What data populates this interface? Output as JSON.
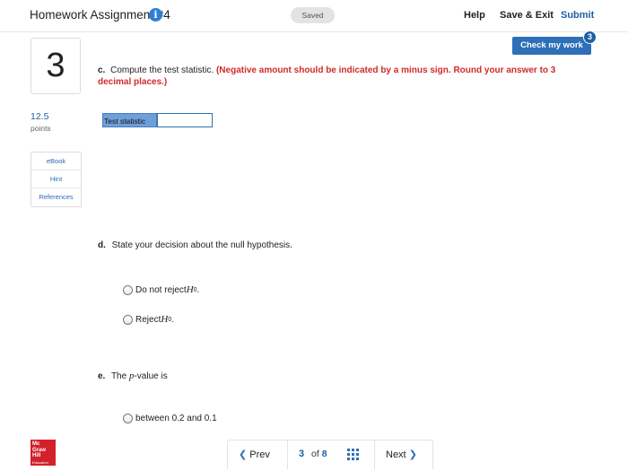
{
  "header": {
    "title": "Homework Assignment #4",
    "info_icon": "info-icon",
    "saved": "Saved",
    "help": "Help",
    "save_exit": "Save & Exit",
    "submit": "Submit"
  },
  "check_work": {
    "label": "Check my work",
    "badge": "3"
  },
  "question": {
    "number": "3",
    "points_value": "12.5",
    "points_label": "points"
  },
  "resources": [
    "eBook",
    "Hint",
    "References"
  ],
  "part_c": {
    "label": "c.",
    "text": "Compute the test statistic.",
    "instruction": "(Negative amount should be indicated by a minus sign. Round your answer to 3 decimal places.)",
    "field_label": "Test statistic",
    "field_value": ""
  },
  "part_d": {
    "label": "d.",
    "text": "State your decision about the null hypothesis.",
    "options": [
      {
        "text": "Do not reject ",
        "symbol": "H",
        "subscript": "0",
        "end": "."
      },
      {
        "text": "Reject ",
        "symbol": "H",
        "subscript": "0",
        "end": "."
      }
    ]
  },
  "part_e": {
    "label": "e.",
    "text_pre": "The",
    "text_italic": "p",
    "text_post": "-value is",
    "options": [
      "between 0.2 and 0.1"
    ]
  },
  "footer": {
    "logo_lines": [
      "Mc",
      "Graw",
      "Hill"
    ],
    "logo_sub": "Education",
    "prev": "Prev",
    "page_current": "3",
    "page_of": "of",
    "page_total": "8",
    "next": "Next"
  },
  "colors": {
    "accent": "#2e6fb7",
    "link": "#1f5fa6",
    "warning_red": "#d22a2a",
    "logo_red": "#d2212b"
  }
}
